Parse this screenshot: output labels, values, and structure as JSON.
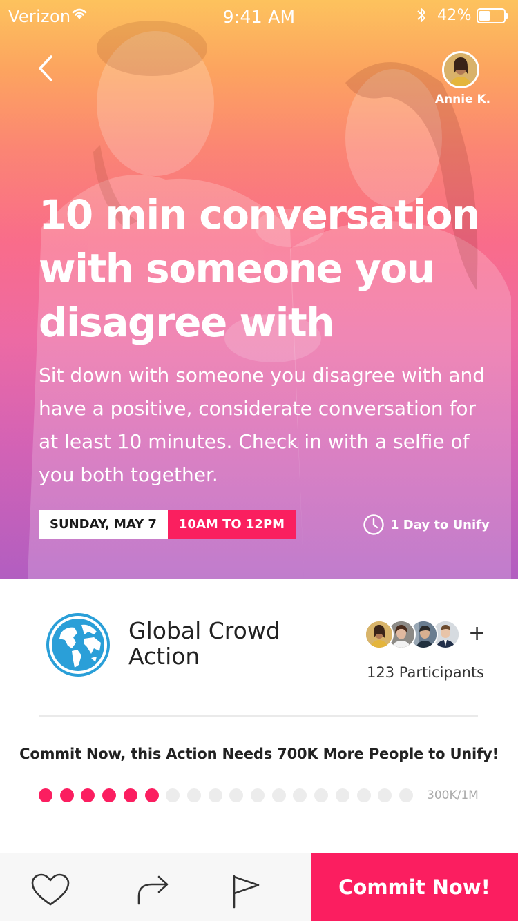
{
  "status_bar": {
    "carrier": "Verizon",
    "time": "9:41 AM",
    "battery": "42%"
  },
  "author": {
    "name": "Annie K."
  },
  "action": {
    "title": "10 min conversation with someone you disagree with",
    "description": "Sit down with someone you disagree with and have a positive, considerate conversation for at least 10 minutes. Check in with a selfie of you both together.",
    "date": "SUNDAY, MAY 7",
    "time": "10AM TO 12PM",
    "countdown": "1 Day to Unify"
  },
  "organizer": {
    "name": "Global Crowd Action",
    "logo_icon": "globe-icon"
  },
  "participants": {
    "count_label": "123 Participants",
    "plus": "+"
  },
  "progress": {
    "message": "Commit Now, this Action Needs 700K More People to Unify!",
    "filled": 6,
    "total": 18,
    "label": "300K/1M"
  },
  "bottom_bar": {
    "like_icon": "heart-icon",
    "share_icon": "share-arrow-icon",
    "report_icon": "flag-icon",
    "commit_label": "Commit Now!"
  },
  "colors": {
    "accent": "#fb1e60",
    "dot_empty": "#ececec",
    "globe": "#2a9fd8"
  }
}
